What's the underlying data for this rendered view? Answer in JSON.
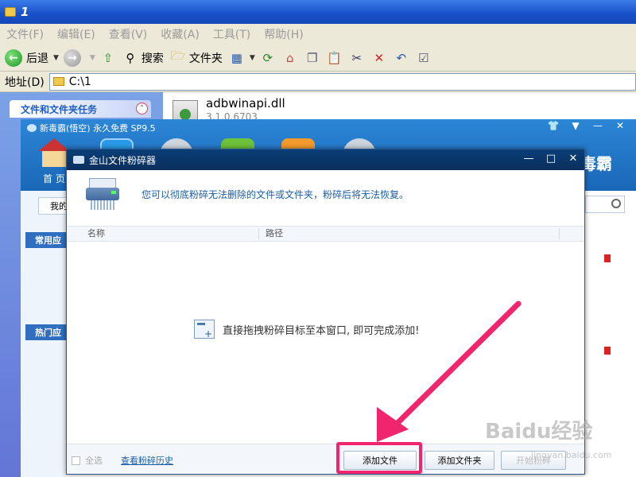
{
  "explorer": {
    "title": "1",
    "menu": [
      "文件(F)",
      "编辑(E)",
      "查看(V)",
      "收藏(A)",
      "工具(T)",
      "帮助(H)"
    ],
    "toolbar": {
      "back_label": "后退",
      "search_label": "搜索",
      "folders_label": "文件夹"
    },
    "address": {
      "label": "地址(D)",
      "value": "C:\\1"
    },
    "left_panel": {
      "tasks_header": "文件和文件夹任务"
    },
    "file": {
      "name": "adbwinapi.dll",
      "version": "3.1.0.6703"
    }
  },
  "duba": {
    "title": "新毒霸(悟空) 永久免费 SP9.5",
    "home_label": "首 页",
    "brand_fragment": "毒霸",
    "tab_fragment": "我的",
    "sections": [
      "常用应",
      "热门应"
    ]
  },
  "dialog": {
    "title": "金山文件粉碎器",
    "description": "您可以彻底粉碎无法删除的文件或文件夹，粉碎后将无法恢复。",
    "columns": {
      "name": "名称",
      "path": "路径"
    },
    "drop_hint": "直接拖拽粉碎目标至本窗口, 即可完成添加!",
    "footer": {
      "select_all": "全选",
      "history_link": "查看粉碎历史",
      "add_file": "添加文件",
      "add_folder": "添加文件夹",
      "start_shred": "开始粉碎"
    }
  },
  "annotation": {
    "color": "#f0256d"
  },
  "watermark": {
    "text": "Baidu经验",
    "sub": "jingyan.baidu.com"
  }
}
